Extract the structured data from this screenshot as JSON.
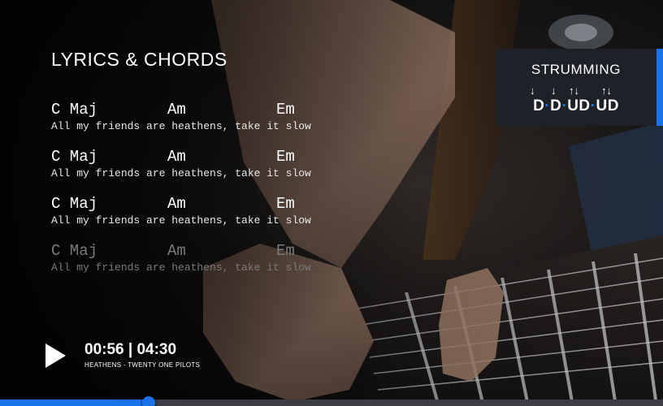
{
  "header": {
    "title": "LYRICS & CHORDS"
  },
  "lyrics": [
    {
      "chords": [
        "C Maj",
        "Am",
        "Em"
      ],
      "text": "All my friends are heathens, take it slow",
      "faded": false
    },
    {
      "chords": [
        "C Maj",
        "Am",
        "Em"
      ],
      "text": "All my friends are heathens, take it slow",
      "faded": false
    },
    {
      "chords": [
        "C Maj",
        "Am",
        "Em"
      ],
      "text": "All my friends are heathens, take it slow",
      "faded": false
    },
    {
      "chords": [
        "C Maj",
        "Am",
        "Em"
      ],
      "text": "All my friends are heathens, take it slow",
      "faded": true
    }
  ],
  "strumming": {
    "title": "STRUMMING",
    "arrows": [
      "↓",
      "↓",
      "↑↓",
      "↑↓"
    ],
    "pattern": [
      "D",
      "D",
      "UD",
      "UD"
    ],
    "accent_color": "#1a73e8"
  },
  "player": {
    "play_icon": "play-icon",
    "current_time": "00:56",
    "total_time": "04:30",
    "time_display": "00:56 | 04:30",
    "song": "HEATHENS - TWENTY ONE PILOTS",
    "progress_fraction": 0.224
  },
  "colors": {
    "accent": "#1a73e8",
    "panel": "#1e2127",
    "track": "#3b3d42"
  }
}
